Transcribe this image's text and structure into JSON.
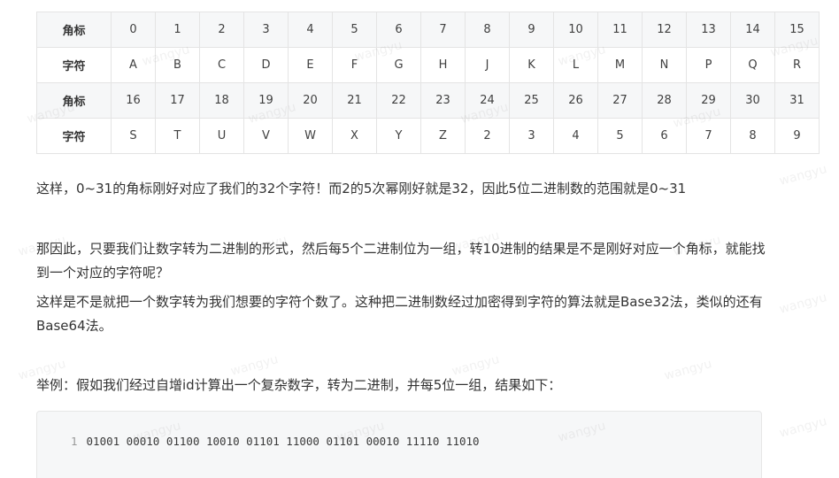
{
  "table": {
    "rows": [
      {
        "header": "角标",
        "cells": [
          "0",
          "1",
          "2",
          "3",
          "4",
          "5",
          "6",
          "7",
          "8",
          "9",
          "10",
          "11",
          "12",
          "13",
          "14",
          "15"
        ]
      },
      {
        "header": "字符",
        "cells": [
          "A",
          "B",
          "C",
          "D",
          "E",
          "F",
          "G",
          "H",
          "J",
          "K",
          "L",
          "M",
          "N",
          "P",
          "Q",
          "R"
        ]
      },
      {
        "header": "角标",
        "cells": [
          "16",
          "17",
          "18",
          "19",
          "20",
          "21",
          "22",
          "23",
          "24",
          "25",
          "26",
          "27",
          "28",
          "29",
          "30",
          "31"
        ]
      },
      {
        "header": "字符",
        "cells": [
          "S",
          "T",
          "U",
          "V",
          "W",
          "X",
          "Y",
          "Z",
          "2",
          "3",
          "4",
          "5",
          "6",
          "7",
          "8",
          "9"
        ]
      }
    ]
  },
  "paragraphs": {
    "p1": "这样，0~31的角标刚好对应了我们的32个字符！而2的5次幂刚好就是32，因此5位二进制数的范围就是0~31",
    "p2": "那因此，只要我们让数字转为二进制的形式，然后每5个二进制位为一组，转10进制的结果是不是刚好对应一个角标，就能找到一个对应的字符呢？",
    "p3": "这样是不是就把一个数字转为我们想要的字符个数了。这种把二进制数经过加密得到字符的算法就是Base32法，类似的还有Base64法。",
    "p4": "举例：假如我们经过自增id计算出一个复杂数字，转为二进制，并每5位一组，结果如下："
  },
  "code": {
    "line_number": "1",
    "line": "01001 00010 01100 10010 01101 11000 01101 00010 11110 11010"
  },
  "watermark": "wangyu"
}
